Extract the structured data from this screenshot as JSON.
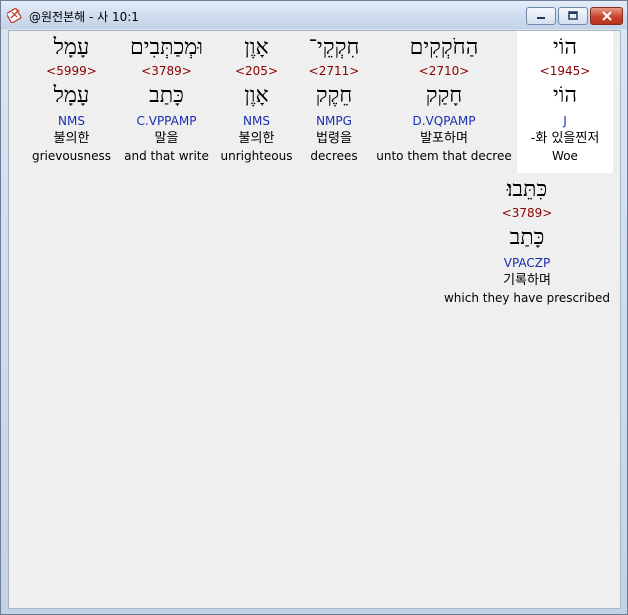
{
  "window": {
    "title": "@원전본해 - 사 10:1"
  },
  "words": [
    {
      "hebrew": "הוֹי",
      "strong": "<1945>",
      "lemma": "הוֹי",
      "morph": "J",
      "korean": "-화 있을찐저",
      "english": "Woe"
    },
    {
      "hebrew": "הַחֹקְקִים",
      "strong": "<2710>",
      "lemma": "חָקַק",
      "morph": "D.VQPAMP",
      "korean": "발포하며",
      "english": "unto them that decree"
    },
    {
      "hebrew": "חִקְקֵי־",
      "strong": "<2711>",
      "lemma": "חֵקֶק",
      "morph": "NMPG",
      "korean": "법령을",
      "english": "decrees"
    },
    {
      "hebrew": "אָוֶן",
      "strong": "<205>",
      "lemma": "אָוֶן",
      "morph": "NMS",
      "korean": "불의한",
      "english": "unrighteous"
    },
    {
      "hebrew": "וּמְכַתְּבִים",
      "strong": "<3789>",
      "lemma": "כָּתַב",
      "morph": "C.VPPAMP",
      "korean": "말을",
      "english": "and that write"
    },
    {
      "hebrew": "עָמָל",
      "strong": "<5999>",
      "lemma": "עָמָל",
      "morph": "NMS",
      "korean": "불의한",
      "english": "grievousness"
    },
    {
      "hebrew": "כִּתֵּבוּ׃",
      "strong": "<3789>",
      "lemma": "כָּתַב",
      "morph": "VPACZP",
      "korean": "기록하며",
      "english": "which they have prescribed"
    }
  ]
}
